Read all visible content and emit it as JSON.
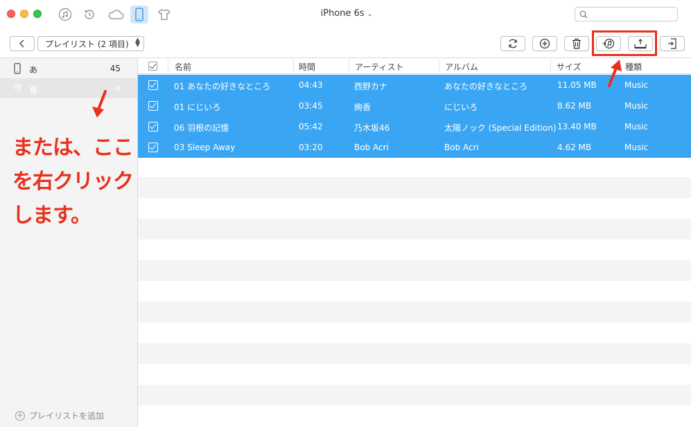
{
  "titlebar": {
    "device_title": "iPhone 6s",
    "search_placeholder": ""
  },
  "toolbar": {
    "playlist_select": "プレイリスト (2 項目)"
  },
  "sidebar": {
    "items": [
      {
        "name": "あ",
        "count": "45",
        "icon": "phone-icon"
      },
      {
        "name": "春",
        "count": "4",
        "icon": "music-list-icon"
      }
    ],
    "add_playlist_label": "プレイリストを追加"
  },
  "table": {
    "headers": [
      "名前",
      "時間",
      "アーティスト",
      "アルバム",
      "サイズ",
      "種類"
    ],
    "rows": [
      {
        "name": "01 あなたの好きなところ",
        "time": "04:43",
        "artist": "西野カナ",
        "album": "あなたの好きなところ",
        "size": "11.05 MB",
        "kind": "Music"
      },
      {
        "name": "01 にじいろ",
        "time": "03:45",
        "artist": "絢香",
        "album": "にじいろ",
        "size": "8.62 MB",
        "kind": "Music"
      },
      {
        "name": "06 羽根の記憶",
        "time": "05:42",
        "artist": "乃木坂46",
        "album": "太陽ノック (Special Edition)",
        "size": "13.40 MB",
        "kind": "Music"
      },
      {
        "name": "03 Sleep Away",
        "time": "03:20",
        "artist": "Bob Acri",
        "album": "Bob Acri",
        "size": "4.62 MB",
        "kind": "Music"
      }
    ]
  },
  "annotation": {
    "line1": "または、ここ",
    "line2": "を右クリック",
    "line3": "します。"
  },
  "colors": {
    "selection": "#3aa6f3",
    "highlight": "#e8301c"
  }
}
